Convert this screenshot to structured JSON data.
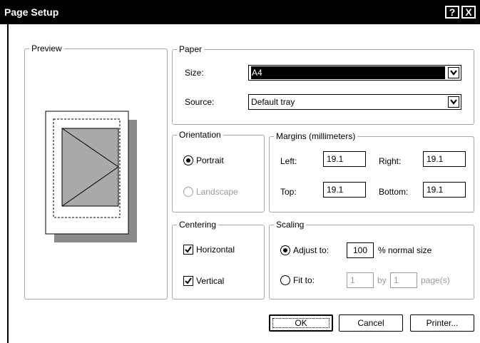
{
  "window": {
    "title": "Page Setup",
    "help_glyph": "?",
    "close_glyph": "X"
  },
  "preview": {
    "label": "Preview"
  },
  "paper": {
    "label": "Paper",
    "size_label": "Size:",
    "size_value": "A4",
    "source_label": "Source:",
    "source_value": "Default tray"
  },
  "orientation": {
    "label": "Orientation",
    "portrait": "Portrait",
    "landscape": "Landscape"
  },
  "margins": {
    "label": "Margins (millimeters)",
    "left_label": "Left:",
    "left_value": "19.1",
    "right_label": "Right:",
    "right_value": "19.1",
    "top_label": "Top:",
    "top_value": "19.1",
    "bottom_label": "Bottom:",
    "bottom_value": "19.1"
  },
  "centering": {
    "label": "Centering",
    "horizontal": "Horizontal",
    "vertical": "Vertical"
  },
  "scaling": {
    "label": "Scaling",
    "adjust_label": "Adjust to:",
    "adjust_value": "100",
    "adjust_suffix": "% normal size",
    "fit_label": "Fit to:",
    "fit_wide_value": "1",
    "fit_by": "by",
    "fit_tall_value": "1",
    "fit_suffix": "page(s)"
  },
  "buttons": {
    "ok": "OK",
    "cancel": "Cancel",
    "printer": "Printer..."
  }
}
